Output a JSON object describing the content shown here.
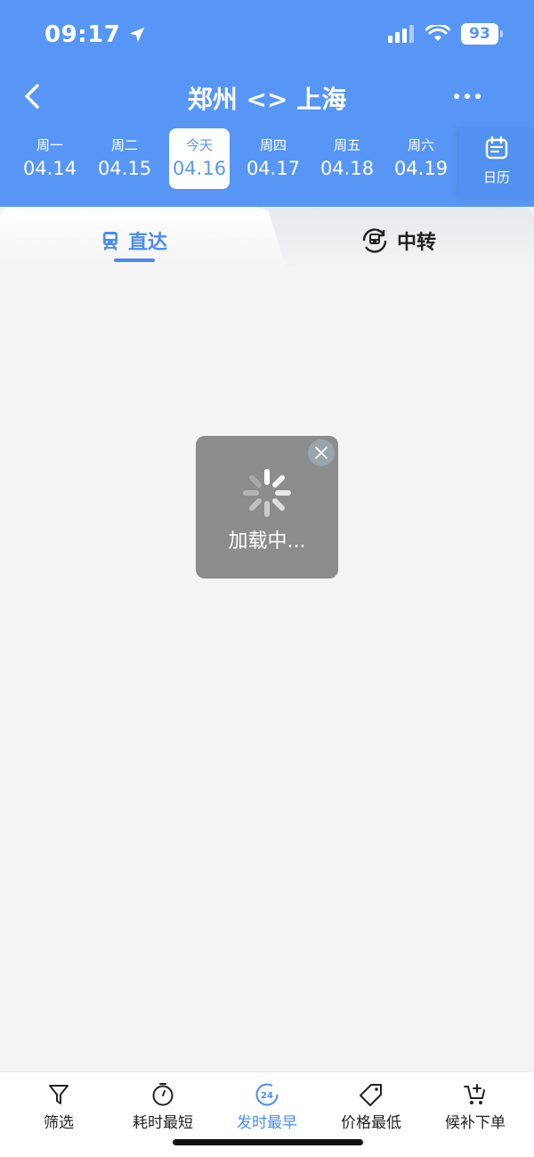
{
  "status": {
    "time": "09:17",
    "battery": "93"
  },
  "nav": {
    "title": "郑州 <> 上海"
  },
  "dates": [
    {
      "weekday": "周一",
      "date": "04.14"
    },
    {
      "weekday": "周二",
      "date": "04.15"
    },
    {
      "weekday": "今天",
      "date": "04.16"
    },
    {
      "weekday": "周四",
      "date": "04.17"
    },
    {
      "weekday": "周五",
      "date": "04.18"
    },
    {
      "weekday": "周六",
      "date": "04.19"
    }
  ],
  "calendar": {
    "label": "日历"
  },
  "tabs": {
    "direct": "直达",
    "transfer": "中转"
  },
  "loading": {
    "text": "加载中..."
  },
  "bottom": {
    "filter": "筛选",
    "shortest": "耗时最短",
    "earliest": "发时最早",
    "earliest_badge": "24",
    "cheapest": "价格最低",
    "waitlist": "候补下单"
  },
  "colors": {
    "primary": "#5896f5",
    "accent": "#4a8cf0",
    "overlay": "#8c8c8c"
  }
}
